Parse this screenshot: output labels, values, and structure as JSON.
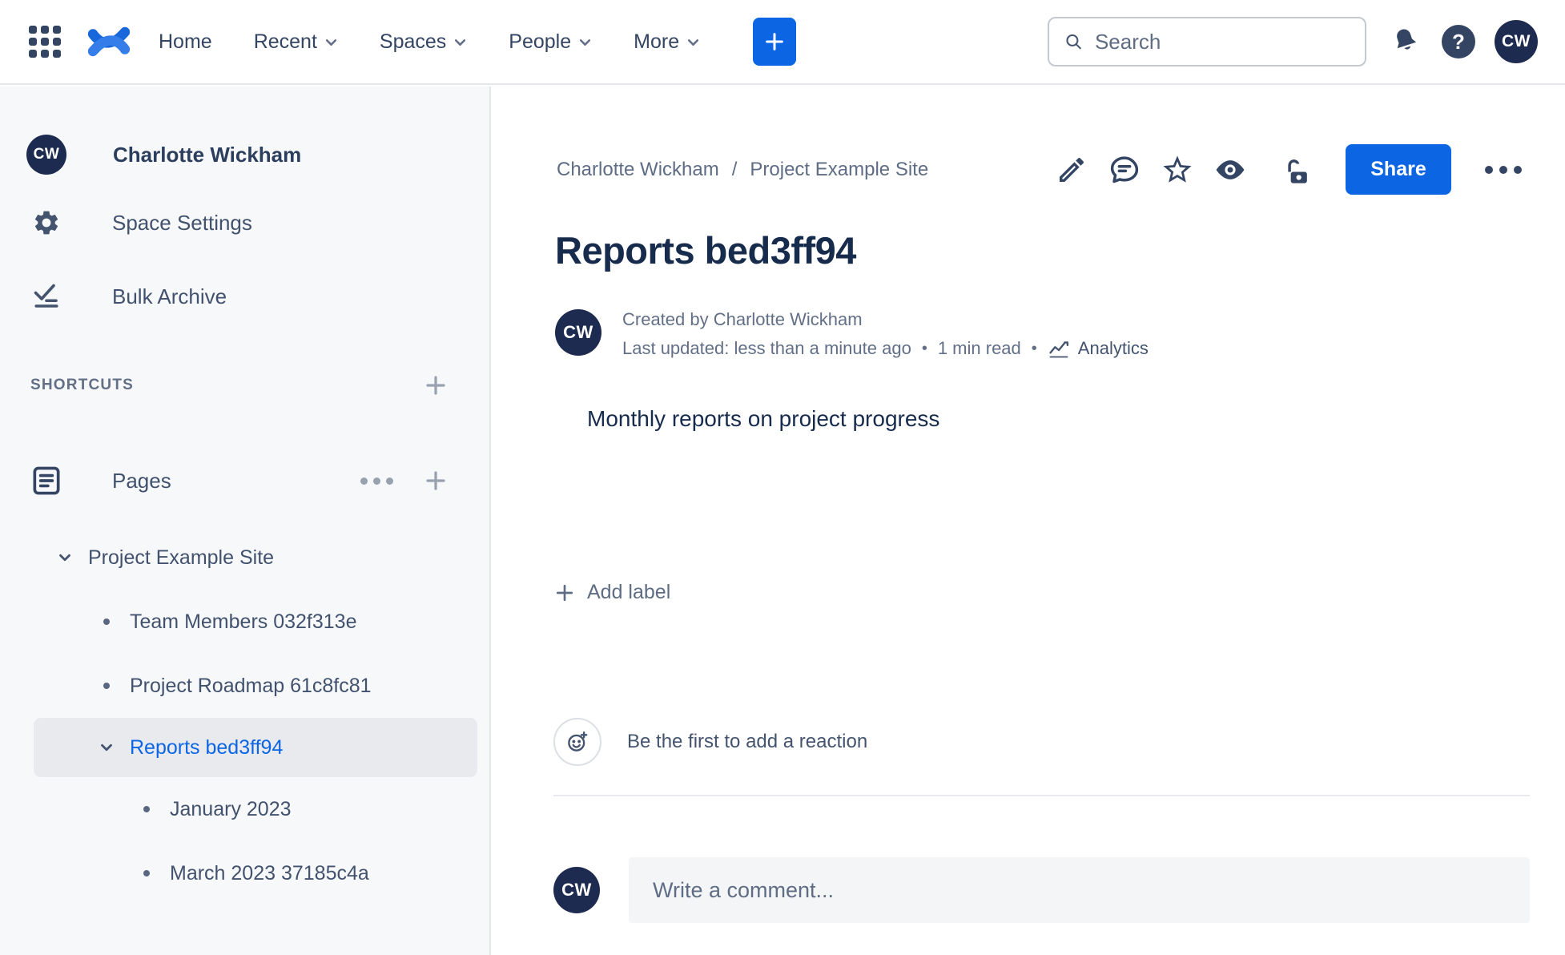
{
  "topbar": {
    "nav": [
      {
        "label": "Home",
        "has_chevron": false
      },
      {
        "label": "Recent",
        "has_chevron": true
      },
      {
        "label": "Spaces",
        "has_chevron": true
      },
      {
        "label": "People",
        "has_chevron": true
      },
      {
        "label": "More",
        "has_chevron": true
      }
    ],
    "search": {
      "placeholder": "Search"
    },
    "avatar_initials": "CW"
  },
  "icons": {
    "help_glyph": "?"
  },
  "sidebar": {
    "space_avatar_initials": "CW",
    "space_name": "Charlotte Wickham",
    "items": [
      {
        "icon": "gear-icon",
        "label": "Space Settings"
      },
      {
        "icon": "bulk-archive-icon",
        "label": "Bulk Archive"
      }
    ],
    "shortcuts_header": "SHORTCUTS",
    "pages_label": "Pages",
    "tree": [
      {
        "label": "Project Example Site",
        "level": 0,
        "marker": "chevron",
        "selected": false
      },
      {
        "label": "Team Members 032f313e",
        "level": 1,
        "marker": "bullet",
        "selected": false
      },
      {
        "label": "Project Roadmap 61c8fc81",
        "level": 1,
        "marker": "bullet",
        "selected": false
      },
      {
        "label": "Reports bed3ff94",
        "level": 1,
        "marker": "chevron",
        "selected": true
      },
      {
        "label": "January 2023",
        "level": 2,
        "marker": "bullet",
        "selected": false
      },
      {
        "label": "March 2023 37185c4a",
        "level": 2,
        "marker": "bullet",
        "selected": false
      }
    ]
  },
  "content": {
    "breadcrumb": {
      "item1": "Charlotte Wickham",
      "separator": "/",
      "item2": "Project Example Site"
    },
    "share_label": "Share",
    "title": "Reports bed3ff94",
    "byline": {
      "initials": "CW",
      "created": "Created by Charlotte Wickham",
      "updated": "Last updated: less than a minute ago",
      "bullet": "•",
      "read_time": "1 min read",
      "analytics_label": "Analytics"
    },
    "body_text": "Monthly reports on project progress",
    "add_label_text": "Add label",
    "reaction_prompt": "Be the first to add a reaction",
    "comment": {
      "initials": "CW",
      "placeholder": "Write a comment..."
    }
  },
  "colors": {
    "accent_blue": "#0C66E4",
    "logo_blue_dark": "#1868DB",
    "logo_blue_light": "#357DE8",
    "avatar_navy": "#1E2B50",
    "heading_text": "#172B4D",
    "secondary_text": "#626F86",
    "sidebar_bg": "#F7F8F9",
    "selected_row_bg": "#E9EAEE",
    "divider": "#E4E6EA",
    "comment_box_bg": "#F4F5F7"
  }
}
